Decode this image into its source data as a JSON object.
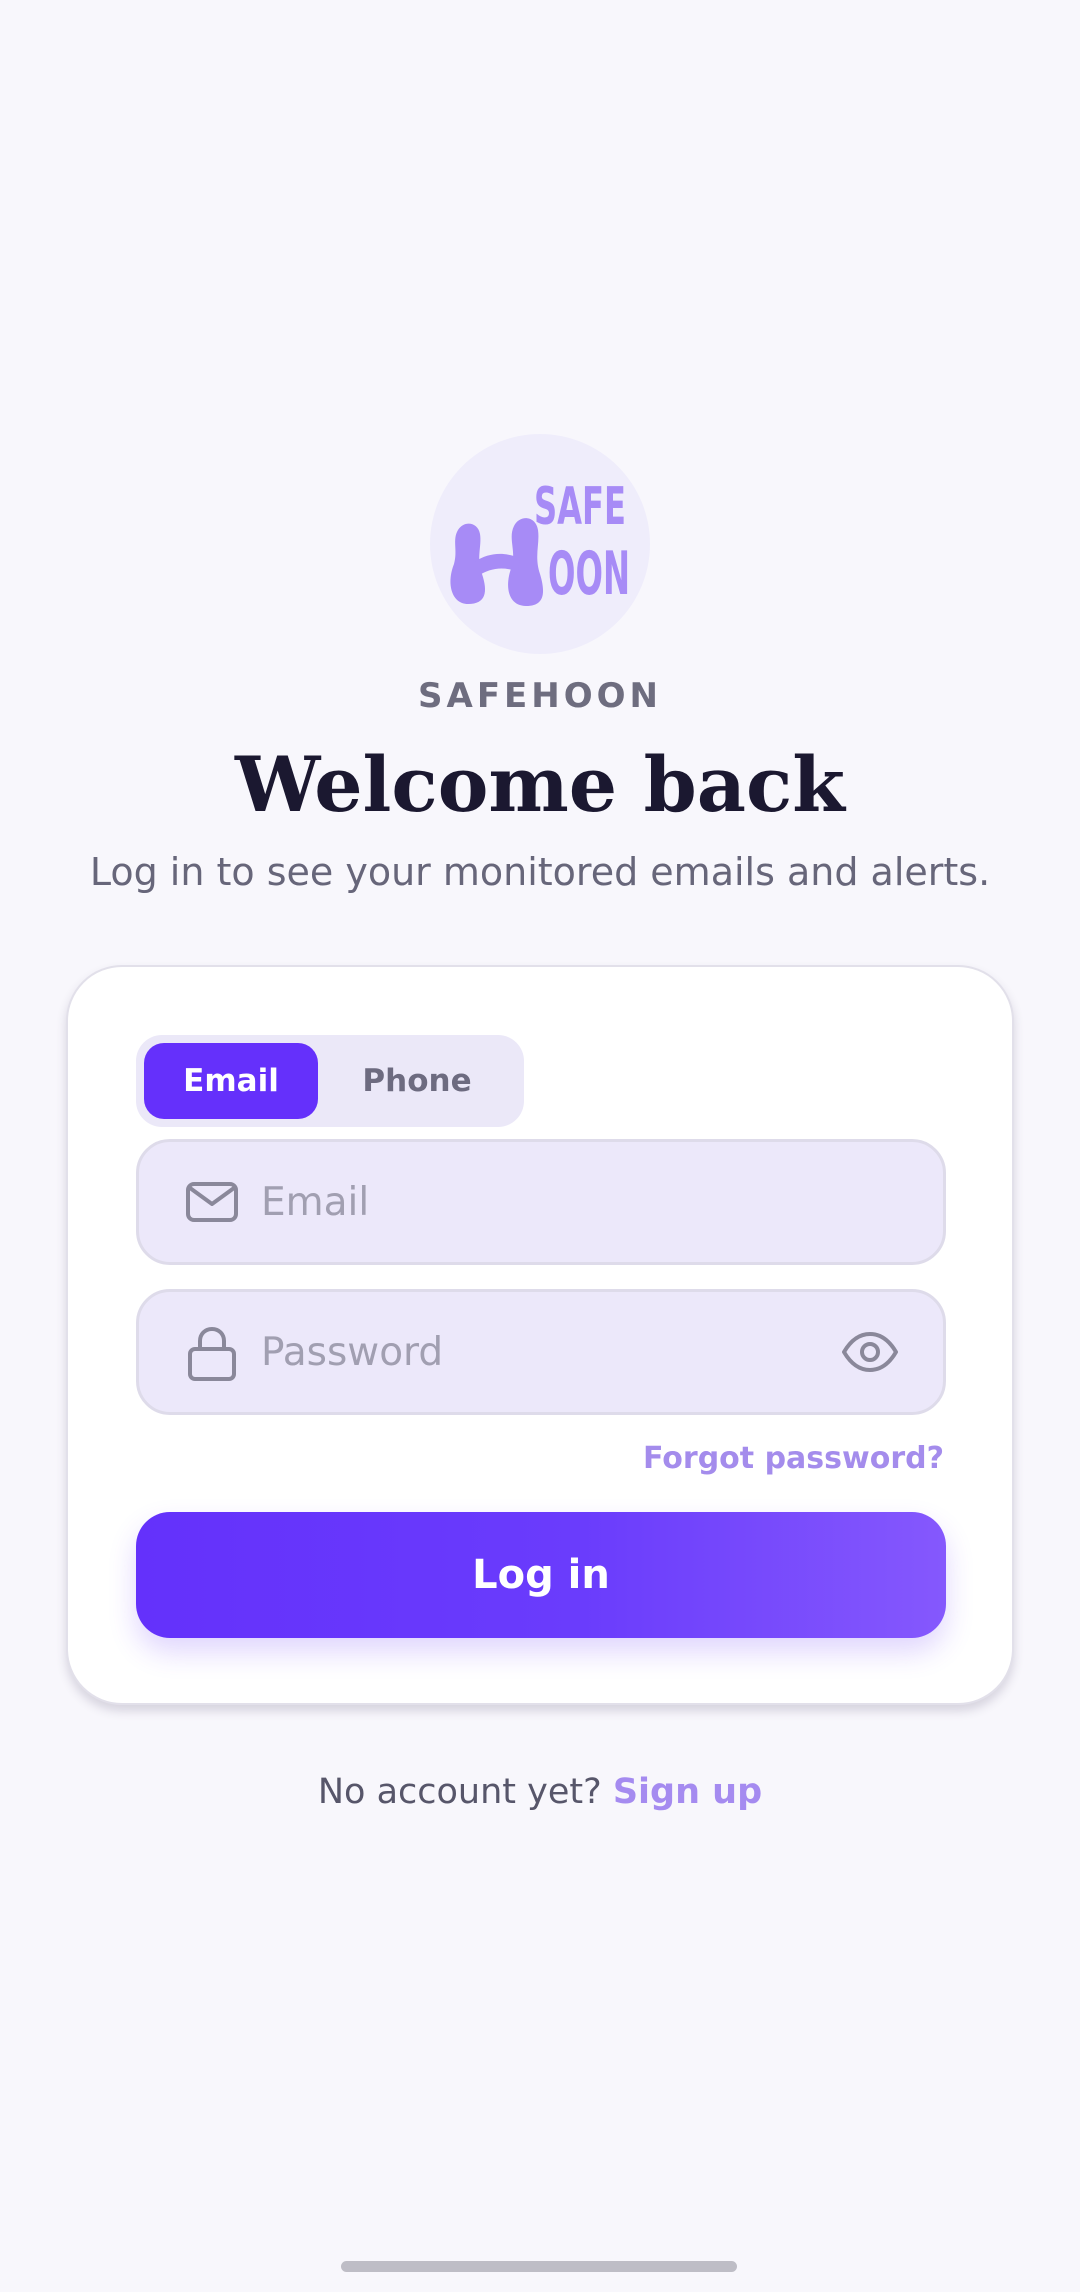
{
  "brand": {
    "logo_text_line1": "SAFE",
    "logo_text_line2": "OON",
    "name": "SAFEHOON",
    "logo_color": "#a78bf6"
  },
  "header": {
    "title": "Welcome back",
    "subtitle": "Log in to see your monitored emails and alerts."
  },
  "login_method": {
    "options": [
      "Email",
      "Phone"
    ],
    "selected": "Email"
  },
  "form": {
    "email_placeholder": "Email",
    "email_value": "",
    "password_placeholder": "Password",
    "password_value": "",
    "forgot_label": "Forgot password?",
    "submit_label": "Log in"
  },
  "footer": {
    "prompt": "No account yet?",
    "signup_label": "Sign up"
  },
  "icons": {
    "email_field": "mail-icon",
    "password_field": "lock-icon",
    "password_toggle": "eye-icon"
  },
  "colors": {
    "accent": "#6530fb",
    "link": "#a58bf0",
    "background": "#f8f7fc",
    "field_fill": "#ece8fa"
  }
}
